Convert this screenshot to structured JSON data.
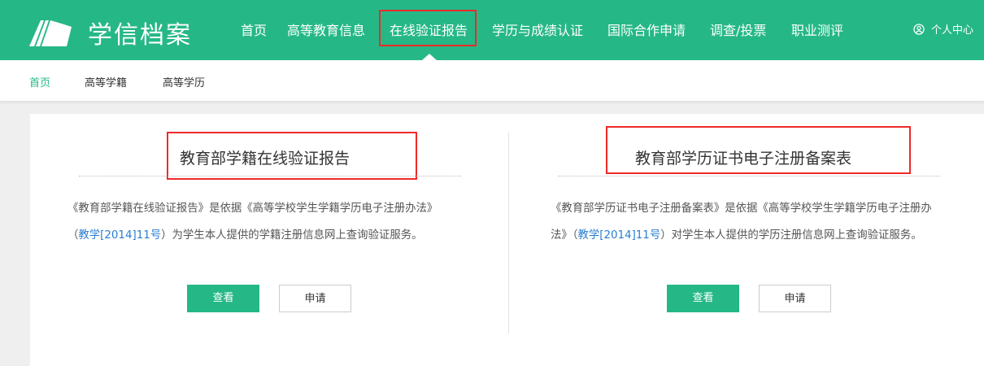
{
  "header": {
    "logo_text": "学信档案",
    "nav": [
      "首页",
      "高等教育信息",
      "在线验证报告",
      "学历与成绩认证",
      "国际合作申请",
      "调查/投票",
      "职业测评"
    ],
    "active": "在线验证报告",
    "user_label": "个人中心"
  },
  "subnav": [
    "首页",
    "高等学籍",
    "高等学历"
  ],
  "colors": {
    "brand": "#25b886",
    "highlight": "#ee2a2a",
    "link": "#2a7ed2"
  },
  "cards": [
    {
      "title": "教育部学籍在线验证报告",
      "desc_pre": "《教育部学籍在线验证报告》是依据《高等学校学生学籍学历电子注册办法》（",
      "link": "教学[2014]11号",
      "desc_post": "）为学生本人提供的学籍注册信息网上查询验证服务。",
      "view": "查看",
      "apply": "申请"
    },
    {
      "title": "教育部学历证书电子注册备案表",
      "desc_pre": "《教育部学历证书电子注册备案表》是依据《高等学校学生学籍学历电子注册办法》（",
      "link": "教学[2014]11号",
      "desc_post": "）对学生本人提供的学历注册信息网上查询验证服务。",
      "view": "查看",
      "apply": "申请"
    }
  ]
}
